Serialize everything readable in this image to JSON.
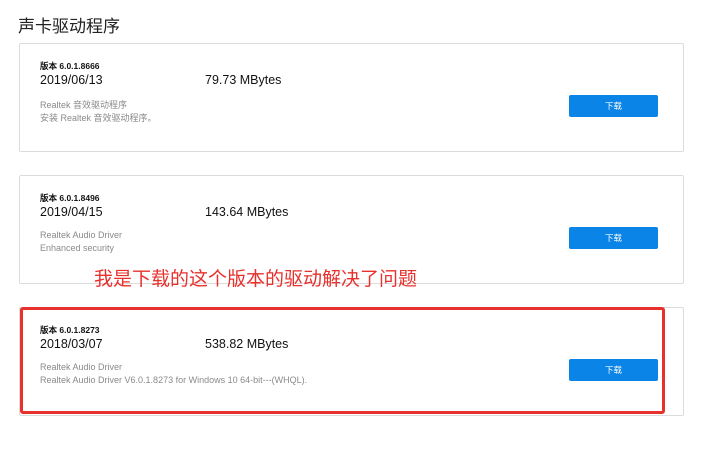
{
  "section": {
    "title": "声卡驱动程序"
  },
  "drivers": [
    {
      "version": "版本 6.0.1.8666",
      "date": "2019/06/13",
      "size": "79.73 MBytes",
      "desc1": "Realtek 音效驱动程序",
      "desc2": "安装 Realtek 音效驱动程序。",
      "download_label": "下载"
    },
    {
      "version": "版本 6.0.1.8496",
      "date": "2019/04/15",
      "size": "143.64 MBytes",
      "desc1": "Realtek Audio Driver",
      "desc2": "Enhanced security",
      "download_label": "下载"
    },
    {
      "version": "版本 6.0.1.8273",
      "date": "2018/03/07",
      "size": "538.82 MBytes",
      "desc1": "Realtek Audio Driver",
      "desc2": "Realtek Audio Driver V6.0.1.8273 for Windows 10 64-bit---(WHQL).",
      "download_label": "下载"
    }
  ],
  "annotation": {
    "text": "我是下载的这个版本的驱动解决了问题"
  },
  "colors": {
    "accent": "#0a84e6",
    "annotation": "#e8302c"
  }
}
